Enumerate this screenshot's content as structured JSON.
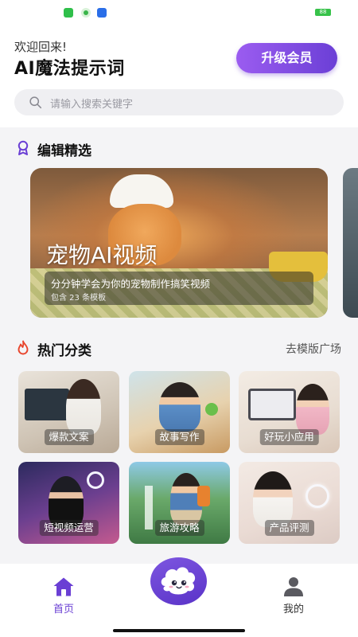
{
  "status_bar": {
    "battery": "88"
  },
  "header": {
    "welcome": "欢迎回来!",
    "title": "AI魔法提示词",
    "upgrade_label": "升级会员"
  },
  "search": {
    "placeholder": "请输入搜索关键字",
    "icon": "search-icon"
  },
  "featured": {
    "section_title": "编辑精选",
    "icon": "award-ribbon-icon",
    "banner": {
      "title": "宠物AI视频",
      "subtitle": "分分钟学会为你的宠物制作搞笑视频",
      "count": "包含 23 条模板"
    }
  },
  "categories": {
    "section_title": "热门分类",
    "icon": "flame-icon",
    "more_link": "去模版广场",
    "items": [
      {
        "label": "爆款文案"
      },
      {
        "label": "故事写作"
      },
      {
        "label": "好玩小应用"
      },
      {
        "label": "短视频运营"
      },
      {
        "label": "旅游攻略"
      },
      {
        "label": "产品评测"
      }
    ]
  },
  "bottom_nav": {
    "home_label": "首页",
    "me_label": "我的",
    "center_icon": "mascot-icon"
  },
  "colors": {
    "accent": "#6a3fd4",
    "accent_light": "#9b5cf0",
    "flame": "#e8452c"
  }
}
